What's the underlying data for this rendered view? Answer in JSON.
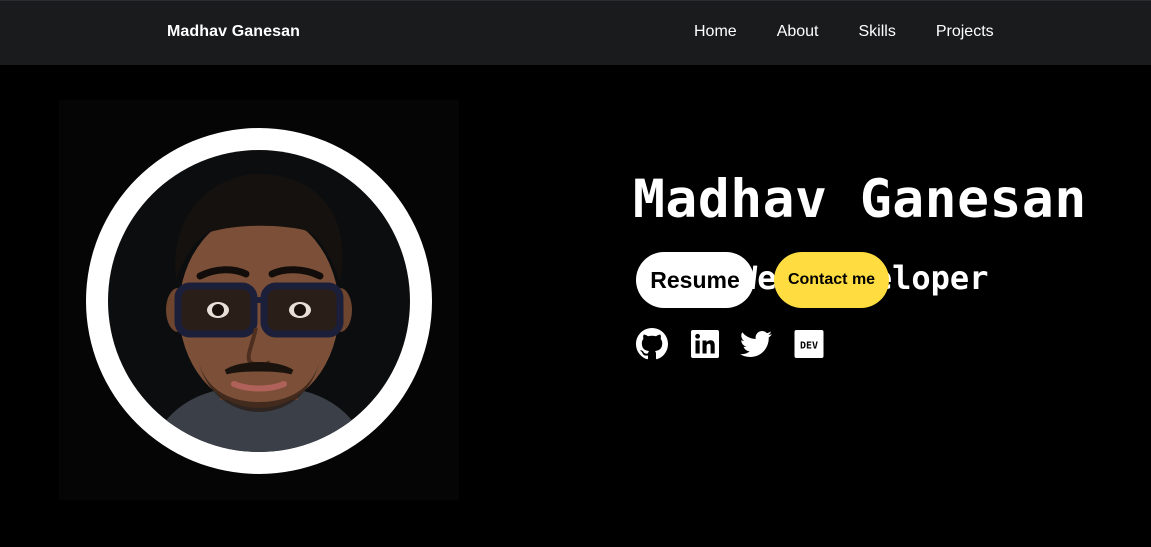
{
  "navbar": {
    "brand": "Madhav Ganesan",
    "links": [
      {
        "label": "Home"
      },
      {
        "label": "About"
      },
      {
        "label": "Skills"
      },
      {
        "label": "Projects"
      }
    ]
  },
  "hero": {
    "name": "Madhav Ganesan",
    "role": "Web Developer",
    "buttons": {
      "resume_label": "Resume",
      "contact_label": "Contact me"
    },
    "socials": [
      {
        "icon": "github-icon"
      },
      {
        "icon": "linkedin-icon"
      },
      {
        "icon": "twitter-icon"
      },
      {
        "icon": "dev-icon",
        "glyph": "DEV"
      }
    ]
  },
  "colors": {
    "navbar_bg": "#191b1d",
    "page_bg": "#000000",
    "contact_button": "#ffdd40",
    "resume_button": "#ffffff"
  }
}
